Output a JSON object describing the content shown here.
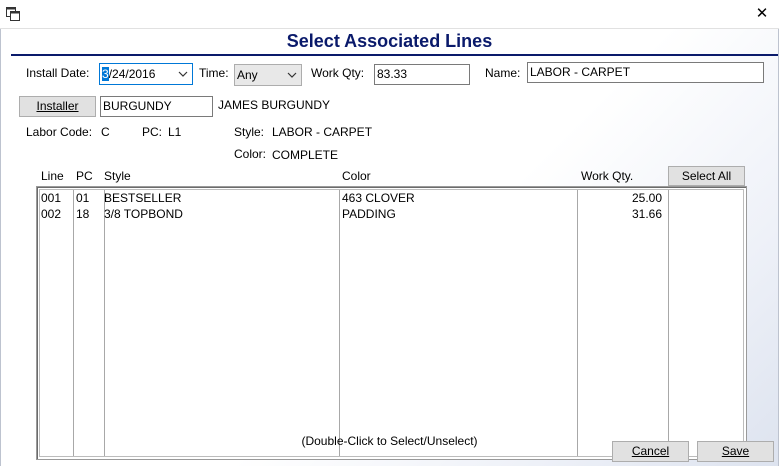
{
  "window": {
    "close_glyph": "✕",
    "icon": "restore-windows-icon"
  },
  "dialog": {
    "title": "Select Associated Lines"
  },
  "form": {
    "install_date_label": "Install Date:",
    "install_date_highlight": "3",
    "install_date_rest": "/24/2016",
    "time_label": "Time:",
    "time_value": "Any",
    "work_qty_label": "Work Qty:",
    "work_qty_value": "83.33",
    "name_label": "Name:",
    "name_value": "LABOR - CARPET",
    "installer_button": "Installer",
    "installer_code": "BURGUNDY",
    "installer_name": "JAMES BURGUNDY",
    "labor_code_label": "Labor Code:",
    "labor_code_value": "C",
    "pc_label": "PC:",
    "pc_value": "L1",
    "style_label": "Style:",
    "style_value": "LABOR - CARPET",
    "color_label": "Color:",
    "color_value": "COMPLETE"
  },
  "table": {
    "headers": {
      "line": "Line",
      "pc": "PC",
      "style": "Style",
      "color": "Color",
      "work_qty": "Work Qty."
    },
    "select_all_button": "Select All",
    "rows": [
      {
        "line": "001",
        "pc": "01",
        "style": "BESTSELLER",
        "color": "463 CLOVER",
        "work_qty": "25.00"
      },
      {
        "line": "002",
        "pc": "18",
        "style": "3/8 TOPBOND",
        "color": "PADDING",
        "work_qty": "31.66"
      }
    ]
  },
  "hint": "(Double-Click to Select/Unselect)",
  "buttons": {
    "cancel": "Cancel",
    "save": "Save"
  },
  "colors": {
    "title": "#0a1a6b",
    "focus_border": "#0078d7",
    "selection": "#0078d7"
  }
}
